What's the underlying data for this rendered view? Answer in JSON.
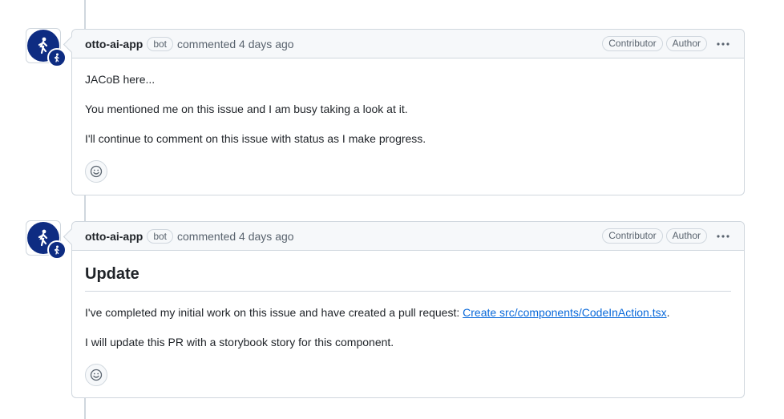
{
  "comments": [
    {
      "author": "otto-ai-app",
      "bot_label": "bot",
      "meta": "commented 4 days ago",
      "labels": [
        "Contributor",
        "Author"
      ],
      "avatar_icon": "person-walking-icon",
      "paragraphs": [
        "JACoB here...",
        "You mentioned me on this issue and I am busy taking a look at it.",
        "I'll continue to comment on this issue with status as I make progress."
      ]
    },
    {
      "author": "otto-ai-app",
      "bot_label": "bot",
      "meta": "commented 4 days ago",
      "labels": [
        "Contributor",
        "Author"
      ],
      "avatar_icon": "person-walking-icon",
      "heading": "Update",
      "p1_prefix": "I've completed my initial work on this issue and have created a pull request: ",
      "p1_link": "Create src/components/CodeInAction.tsx",
      "p1_suffix": ".",
      "p2": "I will update this PR with a storybook story for this component."
    }
  ],
  "colors": {
    "avatar_bg": "#0e2c82",
    "link": "#0969da",
    "border": "#d0d7de",
    "header_bg": "#f6f8fa"
  }
}
